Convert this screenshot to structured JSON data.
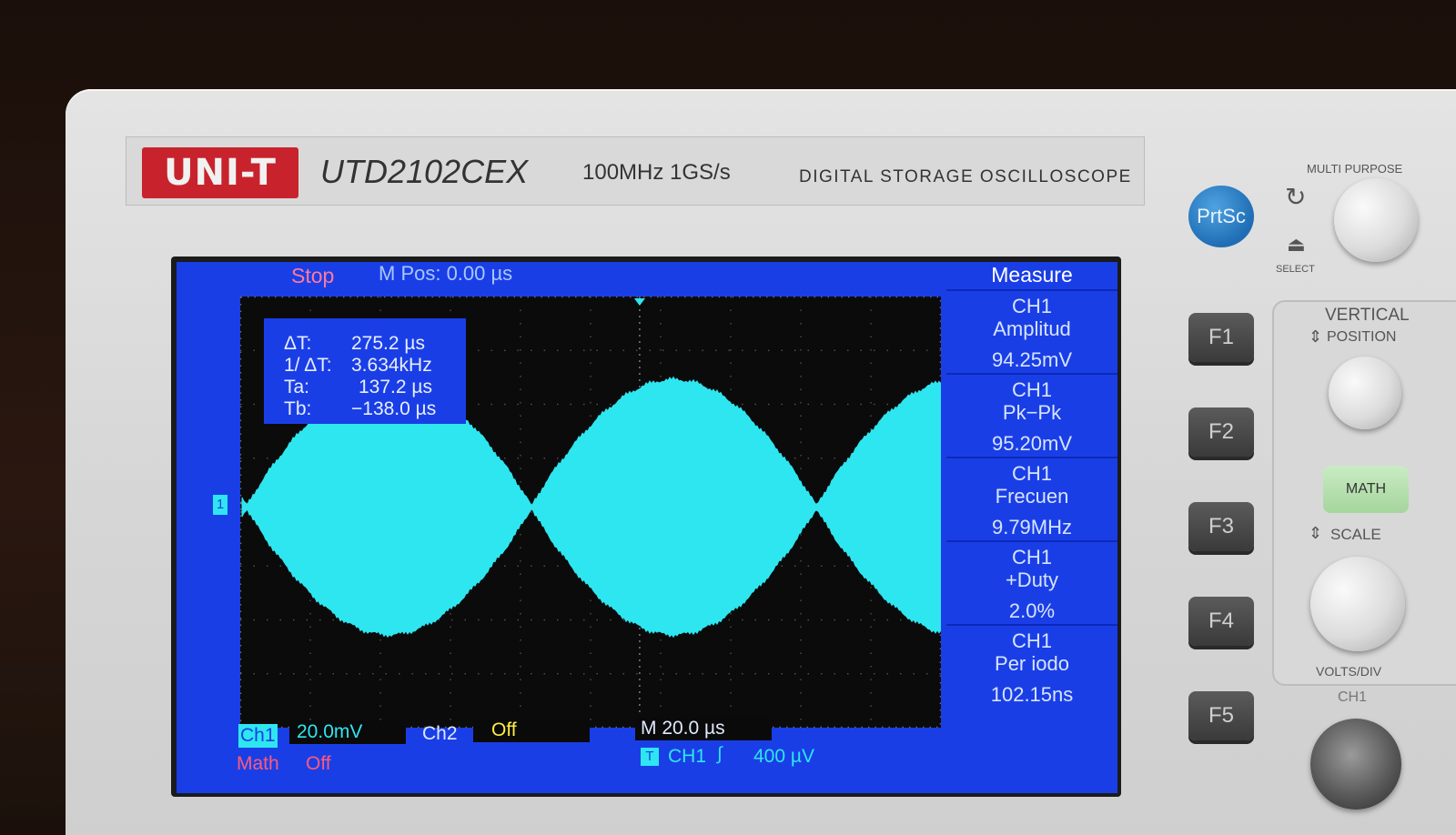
{
  "device": {
    "brand": "UNI-T",
    "model": "UTD2102CEX",
    "spec": "100MHz  1GS/s",
    "type": "DIGITAL STORAGE OSCILLOSCOPE"
  },
  "screen": {
    "run_state": "Stop",
    "m_pos": "M Pos: 0.00 µs",
    "cursors": {
      "rows": [
        {
          "label": "ΔT:",
          "value": "275.2 µs"
        },
        {
          "label": "1/ ΔT:",
          "value": "3.634kHz"
        },
        {
          "label": "Ta:",
          "value": "137.2 µs"
        },
        {
          "label": "Tb:",
          "value": "−138.0 µs"
        }
      ]
    },
    "measure": {
      "title": "Measure",
      "items": [
        {
          "channel": "CH1",
          "name": "Amplitud",
          "value": "94.25mV"
        },
        {
          "channel": "CH1",
          "name": "Pk−Pk",
          "value": "95.20mV"
        },
        {
          "channel": "CH1",
          "name": "Frecuen",
          "value": "9.79MHz"
        },
        {
          "channel": "CH1",
          "name": "+Duty",
          "value": "2.0%"
        },
        {
          "channel": "CH1",
          "name": "Per iodo",
          "value": "102.15ns"
        }
      ]
    },
    "channel_marker": "1",
    "bottom": {
      "ch1_label": "Ch1",
      "ch1_scale": "20.0mV",
      "ch2_label": "Ch2",
      "ch2_state": "Off",
      "timebase": "M 20.0 µs",
      "trigger_icon": "T",
      "trigger_source": "CH1",
      "trigger_level": "400 µV",
      "math_label": "Math",
      "math_state": "Off"
    },
    "colors": {
      "screen_bg": "#1a3ee6",
      "trace": "#2ee6f0",
      "stop": "#ff7a9a"
    }
  },
  "panel": {
    "prtsc": "PrtSc",
    "function_keys": [
      "F1",
      "F2",
      "F3",
      "F4",
      "F5"
    ],
    "multi_purpose": "MULTI PURPOSE",
    "select": "SELECT",
    "vertical": "VERTICAL",
    "position": "POSITION",
    "math": "MATH",
    "scale": "SCALE",
    "volts_div": "VOLTS/DIV",
    "ch1": "CH1"
  }
}
